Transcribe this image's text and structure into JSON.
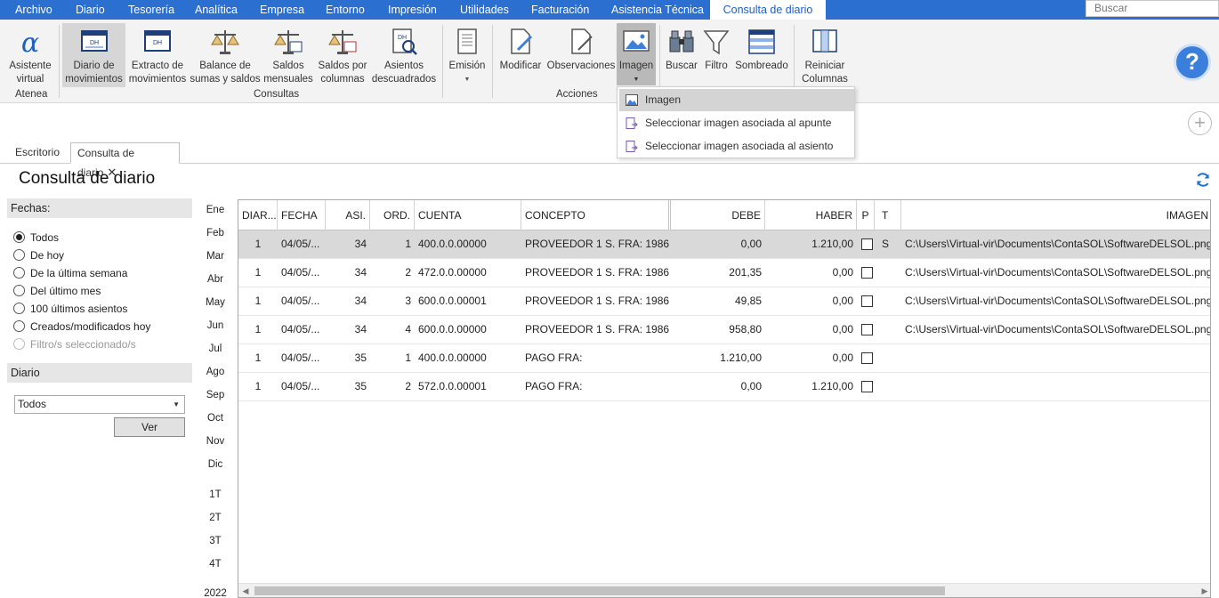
{
  "menubar": {
    "items": [
      "Archivo",
      "Diario",
      "Tesorería",
      "Analítica",
      "Empresa",
      "Entorno",
      "Impresión",
      "Utilidades",
      "Facturación",
      "Asistencia Técnica",
      "Consulta de diario"
    ],
    "search_placeholder": "Buscar",
    "accent": "#2b6fd1"
  },
  "ribbon": {
    "buttons": [
      {
        "label": "Asistente\nvirtual",
        "icon": "alpha-icon"
      },
      {
        "label": "Diario de\nmovimientos",
        "icon": "journal-icon"
      },
      {
        "label": "Extracto de\nmovimientos",
        "icon": "extract-icon"
      },
      {
        "label": "Balance de\nsumas y saldos",
        "icon": "balance-scale-icon"
      },
      {
        "label": "Saldos\nmensuales",
        "icon": "monthly-balance-icon"
      },
      {
        "label": "Saldos por\ncolumnas",
        "icon": "column-balance-icon"
      },
      {
        "label": "Asientos\ndescuadrados",
        "icon": "unbalanced-entries-icon"
      },
      {
        "label": "Emisión",
        "icon": "print-document-icon"
      },
      {
        "label": "Modificar",
        "icon": "edit-document-icon"
      },
      {
        "label": "Observaciones",
        "icon": "notes-icon"
      },
      {
        "label": "Imagen",
        "icon": "image-icon"
      },
      {
        "label": "Buscar",
        "icon": "binoculars-icon"
      },
      {
        "label": "Filtro",
        "icon": "funnel-icon"
      },
      {
        "label": "Sombreado",
        "icon": "shading-icon"
      },
      {
        "label": "Reiniciar\nColumnas",
        "icon": "reset-columns-icon"
      }
    ],
    "groups": [
      "Atenea",
      "Consultas",
      "Acciones"
    ]
  },
  "image_menu": {
    "items": [
      "Imagen",
      "Seleccionar imagen asociada al apunte",
      "Seleccionar imagen asociada al asiento"
    ]
  },
  "tabs": [
    "Escritorio",
    "Consulta de diario"
  ],
  "page_title": "Consulta de diario",
  "filters": {
    "dates_header": "Fechas:",
    "options": [
      "Todos",
      "De hoy",
      "De la última semana",
      "Del último mes",
      "100 últimos asientos",
      "Creados/modificados hoy",
      "Filtro/s seleccionado/s"
    ],
    "selected": "Todos",
    "diario_header": "Diario",
    "diario_value": "Todos",
    "ver_label": "Ver"
  },
  "months": [
    "Ene",
    "Feb",
    "Mar",
    "Abr",
    "May",
    "Jun",
    "Jul",
    "Ago",
    "Sep",
    "Oct",
    "Nov",
    "Dic"
  ],
  "quarters": [
    "1T",
    "2T",
    "3T",
    "4T"
  ],
  "year": "2022",
  "grid": {
    "columns": [
      "DIAR...",
      "FECHA",
      "ASI.",
      "ORD.",
      "CUENTA",
      "CONCEPTO",
      "DEBE",
      "HABER",
      "P",
      "T",
      "IMAGEN"
    ],
    "rows": [
      {
        "diario": "1",
        "fecha": "04/05/...",
        "asi": "34",
        "ord": "1",
        "cuenta": "400.0.0.00000",
        "concepto": "PROVEEDOR 1 S. FRA:  1986",
        "debe": "0,00",
        "haber": "1.210,00",
        "p": false,
        "t": "S",
        "imagen": "C:\\Users\\Virtual-vir\\Documents\\ContaSOL\\SoftwareDELSOL.png"
      },
      {
        "diario": "1",
        "fecha": "04/05/...",
        "asi": "34",
        "ord": "2",
        "cuenta": "472.0.0.00000",
        "concepto": "PROVEEDOR 1 S. FRA:  1986",
        "debe": "201,35",
        "haber": "0,00",
        "p": false,
        "t": "",
        "imagen": "C:\\Users\\Virtual-vir\\Documents\\ContaSOL\\SoftwareDELSOL.png"
      },
      {
        "diario": "1",
        "fecha": "04/05/...",
        "asi": "34",
        "ord": "3",
        "cuenta": "600.0.0.00001",
        "concepto": "PROVEEDOR 1 S. FRA:  1986",
        "debe": "49,85",
        "haber": "0,00",
        "p": false,
        "t": "",
        "imagen": "C:\\Users\\Virtual-vir\\Documents\\ContaSOL\\SoftwareDELSOL.png"
      },
      {
        "diario": "1",
        "fecha": "04/05/...",
        "asi": "34",
        "ord": "4",
        "cuenta": "600.0.0.00000",
        "concepto": "PROVEEDOR 1 S. FRA:  1986",
        "debe": "958,80",
        "haber": "0,00",
        "p": false,
        "t": "",
        "imagen": "C:\\Users\\Virtual-vir\\Documents\\ContaSOL\\SoftwareDELSOL.png"
      },
      {
        "diario": "1",
        "fecha": "04/05/...",
        "asi": "35",
        "ord": "1",
        "cuenta": "400.0.0.00000",
        "concepto": "PAGO FRA:",
        "debe": "1.210,00",
        "haber": "0,00",
        "p": false,
        "t": "",
        "imagen": ""
      },
      {
        "diario": "1",
        "fecha": "04/05/...",
        "asi": "35",
        "ord": "2",
        "cuenta": "572.0.0.00001",
        "concepto": "PAGO FRA:",
        "debe": "0,00",
        "haber": "1.210,00",
        "p": false,
        "t": "",
        "imagen": ""
      }
    ]
  }
}
